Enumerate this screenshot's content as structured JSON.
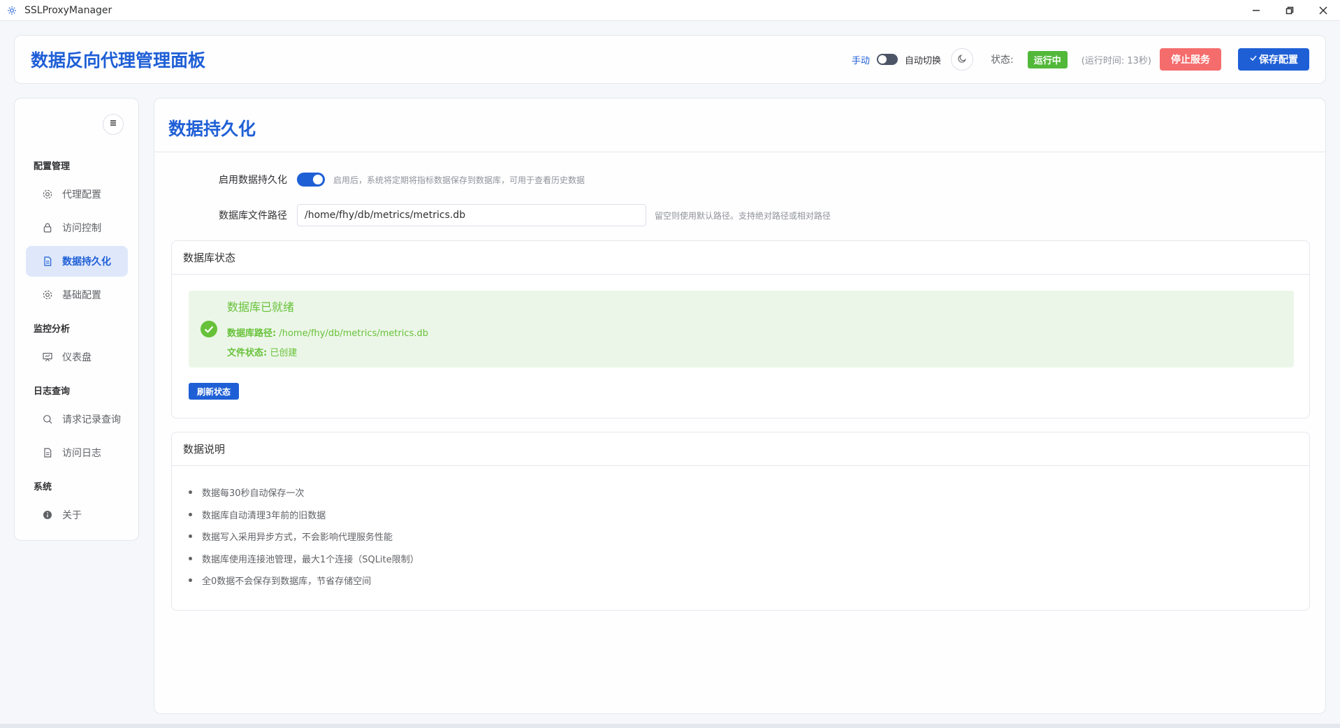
{
  "window": {
    "title": "SSLProxyManager",
    "app_icon": "gear-icon",
    "controls": [
      "minimize-icon",
      "restore-icon",
      "close-icon"
    ]
  },
  "header": {
    "title": "数据反向代理管理面板",
    "mode_manual": "手动",
    "mode_auto": "自动切换",
    "theme_icon": "moon-icon",
    "status_label": "状态:",
    "status_badge": "运行中",
    "uptime": "(运行时间: 13秒)",
    "stop_button": "停止服务",
    "save_button": "保存配置"
  },
  "sidebar": {
    "collapse_icon": "menu-icon",
    "groups": [
      {
        "label": "配置管理"
      },
      {
        "label": "监控分析"
      },
      {
        "label": "日志查询"
      },
      {
        "label": "系统"
      }
    ],
    "items": [
      {
        "label": "代理配置",
        "icon": "gear-icon"
      },
      {
        "label": "访问控制",
        "icon": "lock-icon"
      },
      {
        "label": "数据持久化",
        "icon": "document-icon",
        "active": true
      },
      {
        "label": "基础配置",
        "icon": "gear-icon"
      },
      {
        "label": "仪表盘",
        "icon": "dashboard-icon"
      },
      {
        "label": "请求记录查询",
        "icon": "search-icon"
      },
      {
        "label": "访问日志",
        "icon": "document-icon"
      },
      {
        "label": "关于",
        "icon": "info-icon"
      }
    ]
  },
  "main": {
    "title": "数据持久化",
    "enable_label": "启用数据持久化",
    "enable_hint": "启用后，系统将定期将指标数据保存到数据库，可用于查看历史数据",
    "path_label": "数据库文件路径",
    "path_value": "/home/fhy/db/metrics/metrics.db",
    "path_hint": "留空则使用默认路径。支持绝对路径或相对路径",
    "status_card": {
      "title": "数据库状态",
      "alert_title": "数据库已就绪",
      "path_key": "数据库路径:",
      "path_val": "/home/fhy/db/metrics/metrics.db",
      "file_key": "文件状态:",
      "file_val": "已创建",
      "refresh_button": "刷新状态"
    },
    "notes_card": {
      "title": "数据说明",
      "items": [
        "数据每30秒自动保存一次",
        "数据库自动清理3年前的旧数据",
        "数据写入采用异步方式，不会影响代理服务性能",
        "数据库使用连接池管理，最大1个连接（SQLite限制）",
        "全0数据不会保存到数据库，节省存储空间"
      ]
    }
  },
  "colors": {
    "primary": "#1f5fd6",
    "success": "#67c23a",
    "danger": "#f56c6c",
    "running_badge": "#52b83a"
  }
}
